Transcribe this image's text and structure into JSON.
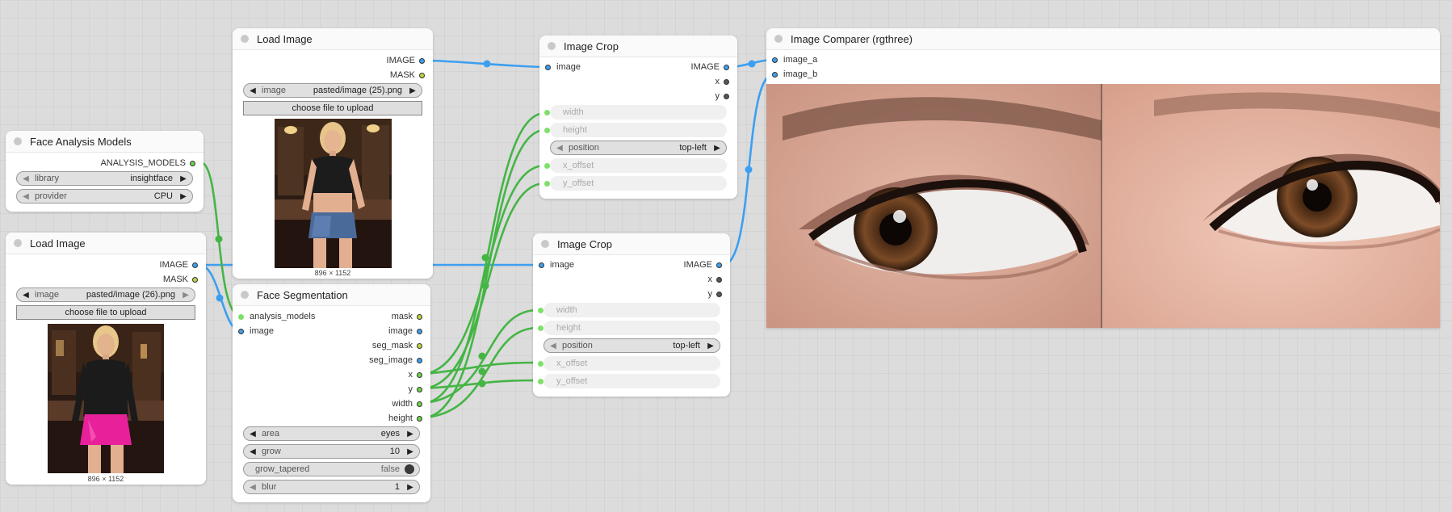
{
  "nodes": {
    "face_analysis": {
      "title": "Face Analysis Models",
      "output": "ANALYSIS_MODELS",
      "library_label": "library",
      "library_value": "insightface",
      "provider_label": "provider",
      "provider_value": "CPU"
    },
    "load_image_1": {
      "title": "Load Image",
      "out_image": "IMAGE",
      "out_mask": "MASK",
      "image_label": "image",
      "image_value": "pasted/image (26).png",
      "upload_label": "choose file to upload",
      "caption": "896 × 1152"
    },
    "load_image_2": {
      "title": "Load Image",
      "out_image": "IMAGE",
      "out_mask": "MASK",
      "image_label": "image",
      "image_value": "pasted/image (25).png",
      "upload_label": "choose file to upload",
      "caption": "896 × 1152"
    },
    "face_seg": {
      "title": "Face Segmentation",
      "in_models": "analysis_models",
      "in_image": "image",
      "outputs": [
        "mask",
        "image",
        "seg_mask",
        "seg_image",
        "x",
        "y",
        "width",
        "height"
      ],
      "area_label": "area",
      "area_value": "eyes",
      "grow_label": "grow",
      "grow_value": "10",
      "tapered_label": "grow_tapered",
      "tapered_value": "false",
      "blur_label": "blur",
      "blur_value": "1"
    },
    "crop_1": {
      "title": "Image Crop",
      "in_image": "image",
      "out_image": "IMAGE",
      "out_x": "x",
      "out_y": "y",
      "width_label": "width",
      "height_label": "height",
      "position_label": "position",
      "position_value": "top-left",
      "xoff_label": "x_offset",
      "yoff_label": "y_offset"
    },
    "crop_2": {
      "title": "Image Crop",
      "in_image": "image",
      "out_image": "IMAGE",
      "out_x": "x",
      "out_y": "y",
      "width_label": "width",
      "height_label": "height",
      "position_label": "position",
      "position_value": "top-left",
      "xoff_label": "x_offset",
      "yoff_label": "y_offset"
    },
    "comparer": {
      "title": "Image Comparer (rgthree)",
      "in_a": "image_a",
      "in_b": "image_b"
    }
  },
  "colors": {
    "image_wire": "#3c9ff0",
    "int_wire": "#45b545",
    "canvas": "#dcdcdc"
  }
}
